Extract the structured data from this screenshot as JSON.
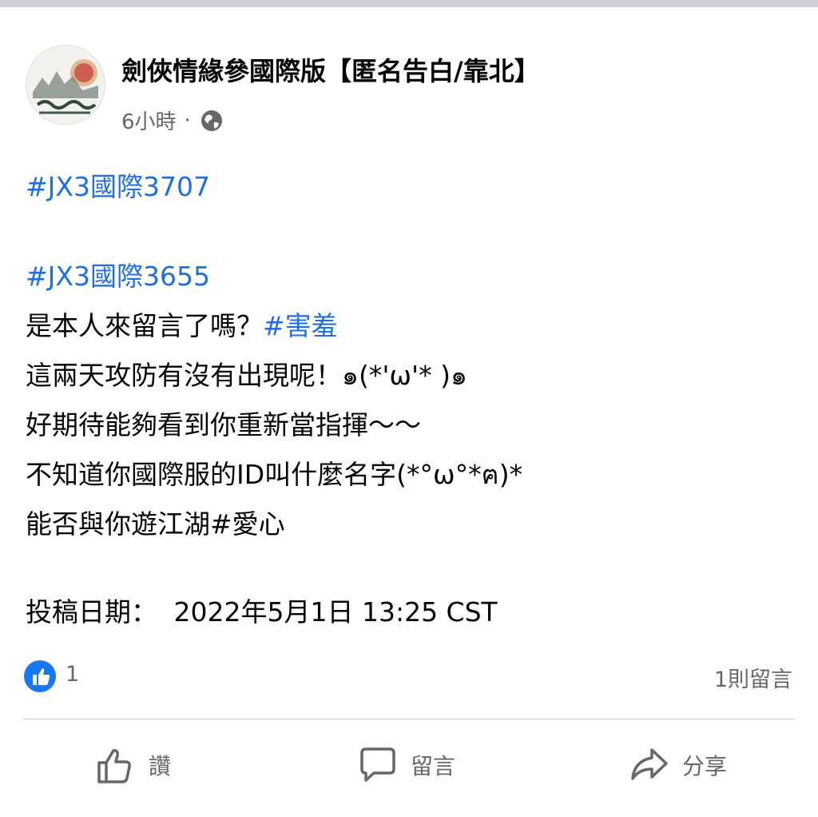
{
  "post": {
    "page_name": "劍俠情緣參國際版【匿名告白/靠北】",
    "time": "6小時",
    "separator": "·",
    "privacy_icon": "globe-icon",
    "lines": {
      "hashtag1": "#JX3國際3707",
      "hashtag2": "#JX3國際3655",
      "line3_text": "是本人來留言了嗎？",
      "line3_tag": "#害羞",
      "line4": "這兩天攻防有沒有出現呢！๑(*'ω'* )๑",
      "line5": "好期待能夠看到你重新當指揮～～",
      "line6": "不知道你國際服的ID叫什麼名字(*°ω°*ฅ)*",
      "line7": "能否與你遊江湖#愛心",
      "date_label": "投稿日期：",
      "date_value": "2022年5月1日 13:25 CST"
    }
  },
  "reactions": {
    "like_icon": "thumbs-up-icon",
    "like_count": "1",
    "comment_count": "1則留言"
  },
  "actions": {
    "like_label": "讚",
    "comment_label": "留言",
    "share_label": "分享"
  },
  "colors": {
    "hashtag": "#216fdb",
    "like_blue": "#1877f2",
    "secondary_text": "#65676b"
  }
}
